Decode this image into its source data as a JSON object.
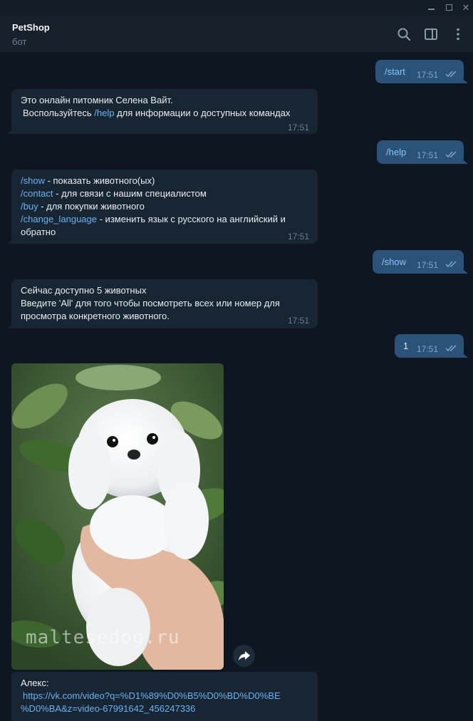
{
  "chat": {
    "title": "PetShop",
    "subtitle": "бот"
  },
  "messages": [
    {
      "dir": "out",
      "text": "/start",
      "time": "17:51"
    },
    {
      "dir": "in",
      "lines": [
        "Это онлайн питомник Селена Вайт.",
        "Воспользуйтесь",
        "/help",
        "для информации о доступных командах"
      ],
      "time": "17:51"
    },
    {
      "dir": "out",
      "text": "/help",
      "time": "17:51"
    },
    {
      "dir": "in",
      "commands": [
        {
          "cmd": "/show",
          "desc": " - показать животного(ых)"
        },
        {
          "cmd": "/contact",
          "desc": " - для связи с нашим специалистом"
        },
        {
          "cmd": "/buy",
          "desc": " - для покупки животного"
        },
        {
          "cmd": "/change_language",
          "desc": " - изменить язык с русского на английский и"
        }
      ],
      "tail": "обратно",
      "time": "17:51"
    },
    {
      "dir": "out",
      "text": "/show",
      "time": "17:51"
    },
    {
      "dir": "in",
      "lines": [
        "Сейчас доступно 5 животных",
        "Введите 'All' для того чтобы посмотреть всех или номер для",
        "просмотра конкретного животного."
      ],
      "time": "17:51"
    },
    {
      "dir": "out",
      "text": "1",
      "time": "17:51"
    },
    {
      "dir": "in",
      "photo_watermark": "maltesedog.ru"
    },
    {
      "dir": "in",
      "caption": "Алекс:",
      "link_1": "https://vk.com/video?q=%D1%89%D0%B5%D0%BD%D0%BE",
      "link_2": "%D0%BA&z=video-67991642_456247336"
    }
  ],
  "icons": [
    "search-icon",
    "side-panel-icon",
    "more-vertical-icon",
    "share-icon",
    "double-check-icon",
    "minimize-icon",
    "maximize-icon",
    "close-icon"
  ],
  "colors": {
    "background": "#0e1621",
    "incoming": "#182533",
    "outgoing": "#2b5278",
    "link": "#6ab2f2",
    "header": "#17212b"
  }
}
